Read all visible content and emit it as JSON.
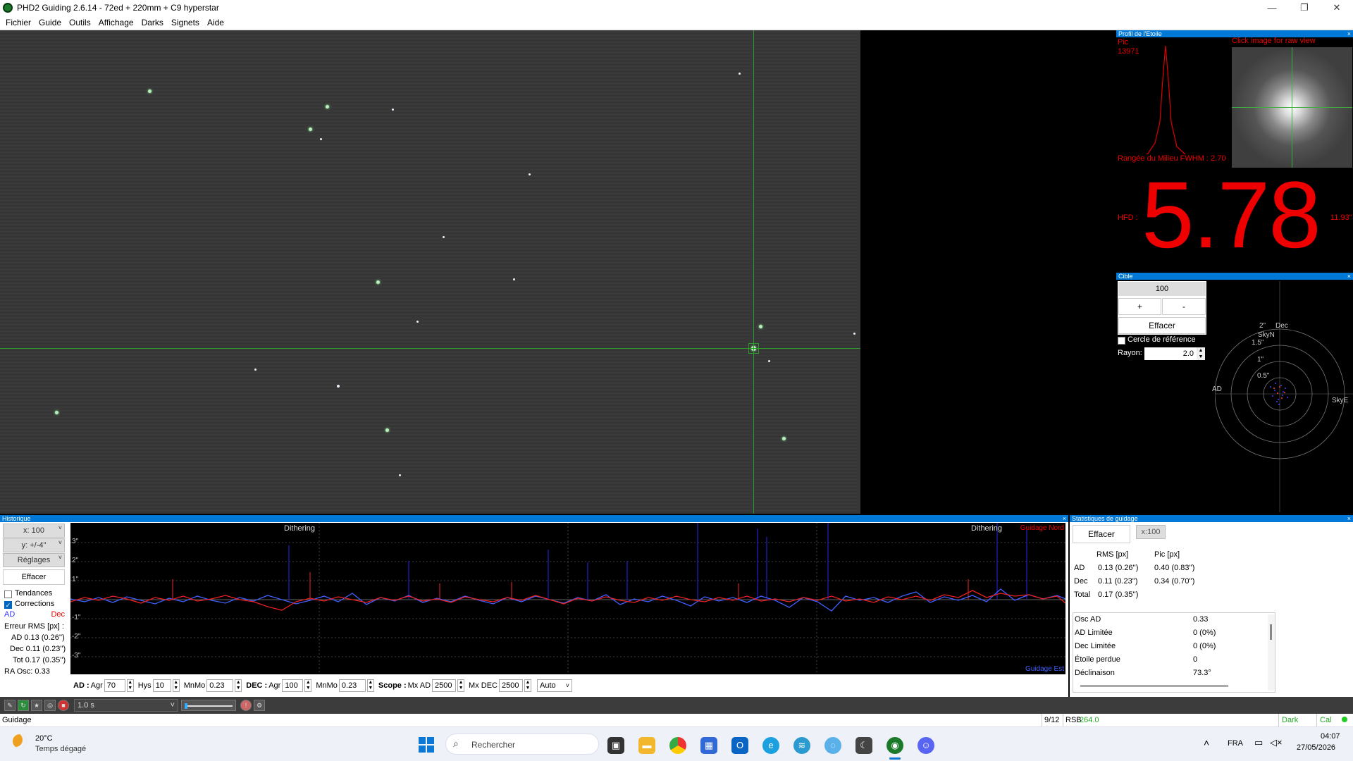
{
  "window": {
    "title": "PHD2 Guiding 2.6.14 - 72ed + 220mm + C9 hyperstar"
  },
  "menu": [
    "Fichier",
    "Guide",
    "Outils",
    "Affichage",
    "Darks",
    "Signets",
    "Aide"
  ],
  "profile": {
    "header": "Profil de l'Etoile",
    "pic_label": "Pic",
    "pic_value": "13971",
    "raw_hint": "Click image for raw view",
    "fwhm": "Rangée du Milieu FWHM : 2.70",
    "hfd_label": "HFD :",
    "hfd_value": "5.78",
    "hfd_arcsec": "11.93\""
  },
  "target": {
    "header": "Cible",
    "zoom": "100",
    "plus": "+",
    "minus": "-",
    "clear": "Effacer",
    "ref_circle": "Cercle de référence",
    "radius_label": "Rayon:",
    "radius_value": "2.0",
    "labels": {
      "dec": "Dec",
      "skyn": "SkyN",
      "ad": "AD",
      "skye": "SkyE",
      "r2": "2\"",
      "r15": "1.5\"",
      "r1": "1\"",
      "r05": "0.5\""
    }
  },
  "history": {
    "header": "Historique",
    "x_scale": "x: 100",
    "y_scale": "y: +/-4\"",
    "settings": "Réglages",
    "clear": "Effacer",
    "trends": "Tendances",
    "corrections": "Corrections",
    "ad_label": "AD",
    "dec_label": "Dec",
    "rms_title": "Erreur RMS [px] :",
    "rms_ad": "AD 0.13 (0.26'')",
    "rms_dec": "Dec 0.11 (0.23'')",
    "rms_tot": "Tot 0.17 (0.35'')",
    "ra_osc": "RA Osc: 0.33",
    "dither1": "Dithering",
    "dither2": "Dithering",
    "guide_north": "Guidage Nord",
    "guide_east": "Guidage Est",
    "yticks": [
      "3\"",
      "2\"",
      "1\"",
      "-1\"",
      "-2\"",
      "-3\""
    ]
  },
  "controls": {
    "ad_title": "AD :",
    "agr_label": "Agr",
    "ad_agr": "70",
    "hys_label": "Hys",
    "ad_hys": "10",
    "mnmo_label": "MnMo",
    "ad_mnmo": "0.23",
    "dec_title": "DEC :",
    "dec_agr": "100",
    "dec_mnmo": "0.23",
    "scope_title": "Scope :",
    "mxad_label": "Mx AD",
    "mxad": "2500",
    "mxdec_label": "Mx DEC",
    "mxdec": "2500",
    "mode": "Auto"
  },
  "stats": {
    "header": "Statistiques de guidage",
    "clear": "Effacer",
    "scale": "x:100",
    "col_rms": "RMS [px]",
    "col_peak": "Pic [px]",
    "rows": [
      {
        "name": "AD",
        "rms": "0.13 (0.26'')",
        "peak": "0.40 (0.83'')"
      },
      {
        "name": "Dec",
        "rms": "0.11 (0.23'')",
        "peak": "0.34 (0.70'')"
      },
      {
        "name": "Total",
        "rms": "0.17 (0.35'')",
        "peak": ""
      }
    ],
    "kv": [
      {
        "k": "Osc AD",
        "v": "0.33"
      },
      {
        "k": "AD Limitée",
        "v": "0 (0%)"
      },
      {
        "k": "Dec Limitée",
        "v": "0 (0%)"
      },
      {
        "k": "Étoile perdue",
        "v": "0"
      },
      {
        "k": "Déclinaison",
        "v": "73.3°"
      }
    ]
  },
  "toolbar": {
    "exposure": "1.0 s"
  },
  "status": {
    "state": "Guidage",
    "frames": "9/12",
    "rsb_label": "RSB",
    "rsb_value": "264.0",
    "dark": "Dark",
    "cal": "Cal"
  },
  "taskbar": {
    "temp": "20°C",
    "weather": "Temps dégagé",
    "search": "Rechercher",
    "lang": "FRA",
    "time": "04:07",
    "date": "27/05/2026"
  }
}
